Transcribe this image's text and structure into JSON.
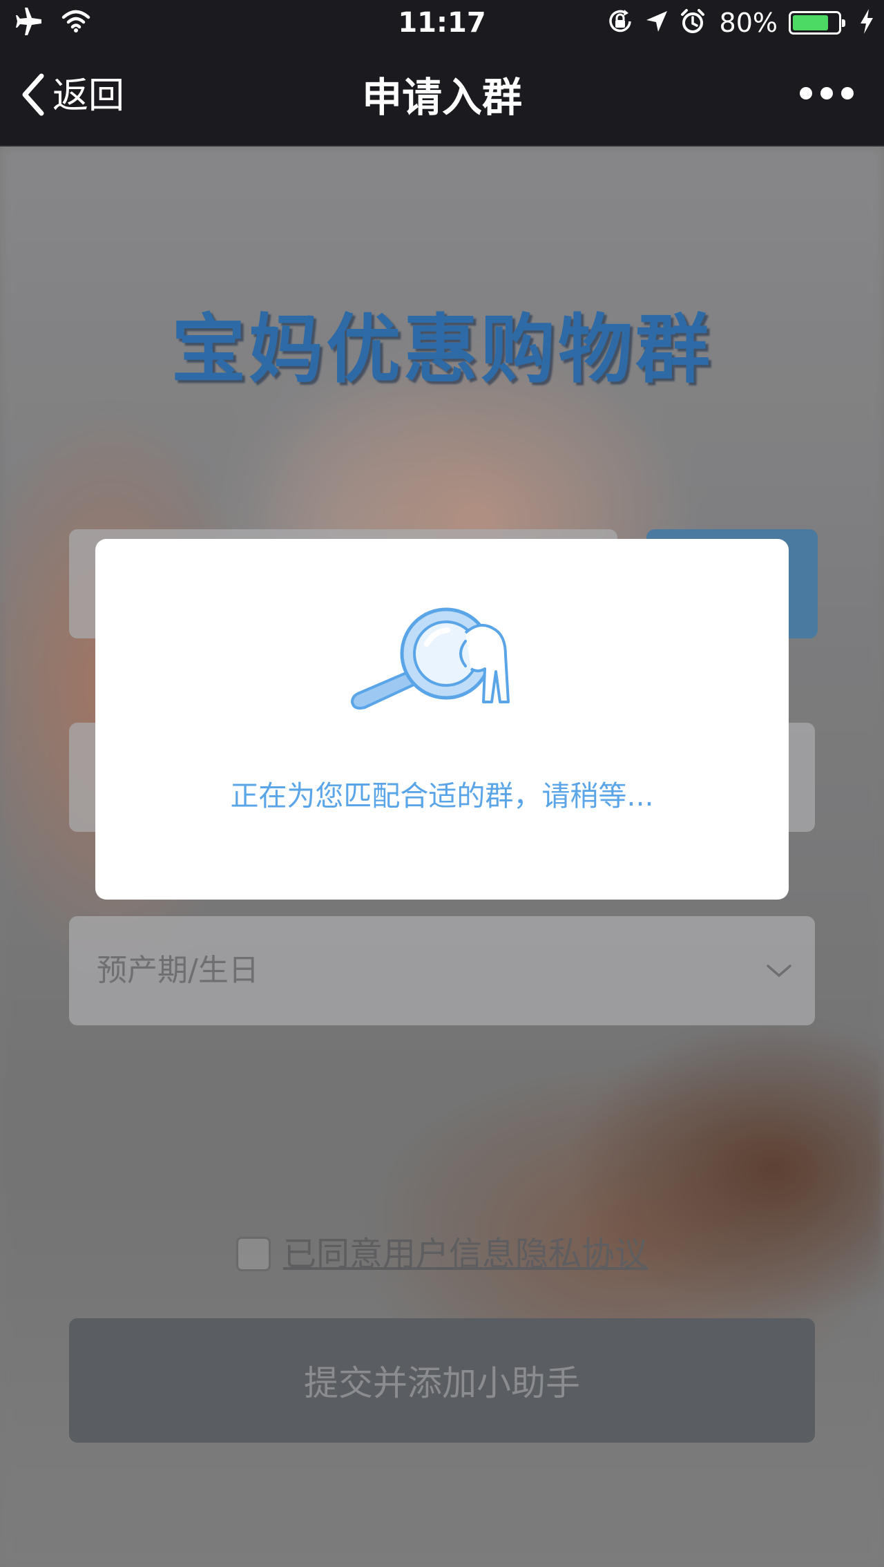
{
  "status_bar": {
    "time": "11:17",
    "battery_percent_label": "80%",
    "battery_level": 0.8,
    "icons": [
      "airplane-mode-icon",
      "wifi-icon",
      "orientation-lock-icon",
      "location-arrow-icon",
      "alarm-icon",
      "battery-icon",
      "charging-bolt-icon"
    ]
  },
  "nav": {
    "back_label": "返回",
    "title": "申请入群",
    "more_icon": "more-dots-icon"
  },
  "page": {
    "group_title": "宝妈优惠购物群",
    "date_field_placeholder": "预产期/生日",
    "agreement_label": "已同意用户信息隐私协议",
    "submit_label": "提交并添加小助手"
  },
  "modal": {
    "icon": "magnifier-search-icon",
    "message": "正在为您匹配合适的群，请稍等..."
  },
  "colors": {
    "bar_background": "#1b1b1f",
    "title_blue": "#2d6aa6",
    "modal_text_blue": "#5aa5e8",
    "battery_green": "#4cd964"
  }
}
